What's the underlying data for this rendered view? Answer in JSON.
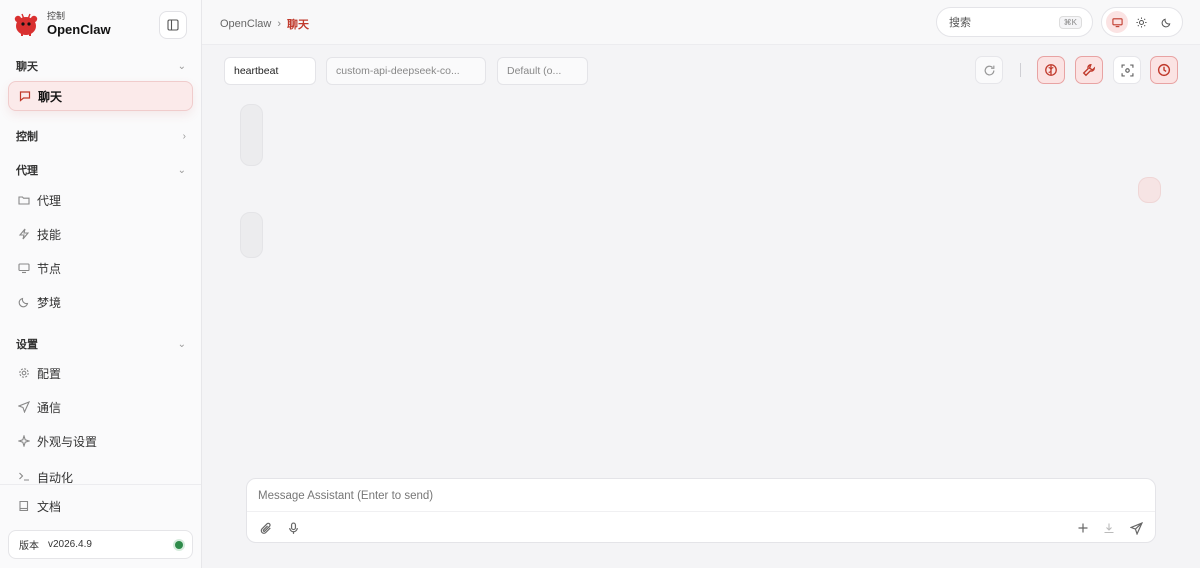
{
  "brand": {
    "subtitle": "控制",
    "name": "OpenClaw"
  },
  "sidebar": {
    "sections": [
      {
        "label": "聊天",
        "chevron": "⌄"
      },
      {
        "label": "控制",
        "chevron": "›"
      },
      {
        "label": "代理",
        "chevron": "⌄"
      },
      {
        "label": "设置",
        "chevron": "⌄"
      }
    ],
    "items": [
      {
        "label": "聊天",
        "icon": "chat-bubble-icon",
        "active": true
      },
      {
        "label": "代理",
        "icon": "folder-icon"
      },
      {
        "label": "技能",
        "icon": "lightning-icon"
      },
      {
        "label": "节点",
        "icon": "monitor-icon"
      },
      {
        "label": "梦境",
        "icon": "moon-icon"
      },
      {
        "label": "配置",
        "icon": "gear-icon"
      },
      {
        "label": "通信",
        "icon": "send-icon"
      },
      {
        "label": "外观与设置",
        "icon": "sparkle-icon"
      },
      {
        "label": "自动化",
        "icon": "terminal-icon"
      },
      {
        "label": "文档",
        "icon": "book-icon"
      }
    ],
    "version": {
      "label": "版本",
      "value": "v2026.4.9",
      "status_color": "#2e8b4a"
    }
  },
  "header": {
    "breadcrumb": {
      "root": "OpenClaw",
      "separator": "›",
      "current": "聊天"
    },
    "search": {
      "placeholder": "搜索",
      "shortcut": "⌘K"
    },
    "theme": {
      "selected": "system"
    }
  },
  "toolbar": {
    "session": "heartbeat",
    "model": "custom-api-deepseek-co...",
    "thinking": "Default (o..."
  },
  "composer": {
    "placeholder": "Message Assistant (Enter to send)"
  },
  "colors": {
    "accent": "#c0392b",
    "accent_bg": "#fbe3e3"
  }
}
